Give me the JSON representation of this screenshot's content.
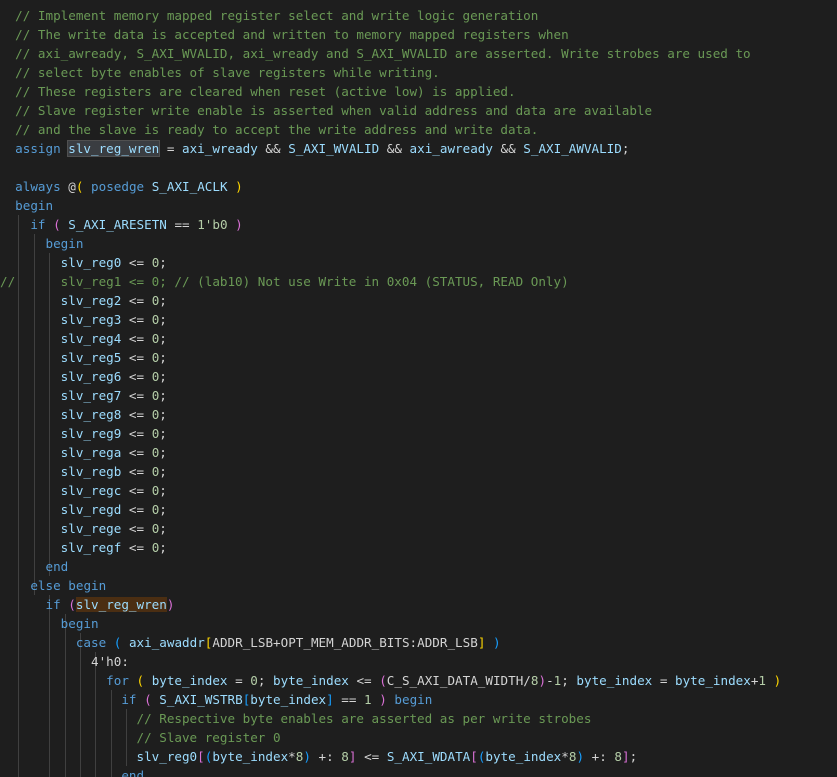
{
  "editor": {
    "language": "verilog",
    "lines": [
      {
        "indent": "  ",
        "tokens": [
          [
            "// Implement memory mapped register select and write logic generation",
            "comment"
          ]
        ]
      },
      {
        "indent": "  ",
        "tokens": [
          [
            "// The write data is accepted and written to memory mapped registers when",
            "comment"
          ]
        ]
      },
      {
        "indent": "  ",
        "tokens": [
          [
            "// axi_awready, S_AXI_WVALID, axi_wready and S_AXI_WVALID are asserted. Write strobes are used to",
            "comment"
          ]
        ]
      },
      {
        "indent": "  ",
        "tokens": [
          [
            "// select byte enables of slave registers while writing.",
            "comment"
          ]
        ]
      },
      {
        "indent": "  ",
        "tokens": [
          [
            "// These registers are cleared when reset (active low) is applied.",
            "comment"
          ]
        ]
      },
      {
        "indent": "  ",
        "tokens": [
          [
            "// Slave register write enable is asserted when valid address and data are available",
            "comment"
          ]
        ]
      },
      {
        "indent": "  ",
        "tokens": [
          [
            "// and the slave is ready to accept the write address and write data.",
            "comment"
          ]
        ]
      },
      {
        "indent": "  ",
        "tokens": [
          [
            "assign",
            "keyword"
          ],
          [
            " ",
            "plain"
          ],
          [
            "slv_reg_wren",
            "ident-select"
          ],
          [
            " = ",
            "plain"
          ],
          [
            "axi_wready",
            "ident"
          ],
          [
            " && ",
            "plain"
          ],
          [
            "S_AXI_WVALID",
            "ident"
          ],
          [
            " && ",
            "plain"
          ],
          [
            "axi_awready",
            "ident"
          ],
          [
            " && ",
            "plain"
          ],
          [
            "S_AXI_AWVALID",
            "ident"
          ],
          [
            ";",
            "plain"
          ]
        ]
      },
      {
        "indent": "",
        "tokens": []
      },
      {
        "indent": "  ",
        "tokens": [
          [
            "always",
            "keyword"
          ],
          [
            " ",
            "plain"
          ],
          [
            "@",
            "plain"
          ],
          [
            "(",
            "bracket-1"
          ],
          [
            " ",
            "plain"
          ],
          [
            "posedge",
            "keyword"
          ],
          [
            " ",
            "plain"
          ],
          [
            "S_AXI_ACLK",
            "ident"
          ],
          [
            " ",
            "plain"
          ],
          [
            ")",
            "bracket-1"
          ]
        ]
      },
      {
        "indent": "  ",
        "tokens": [
          [
            "begin",
            "keyword"
          ]
        ]
      },
      {
        "indent": "    ",
        "tokens": [
          [
            "if",
            "keyword"
          ],
          [
            " ",
            "plain"
          ],
          [
            "(",
            "bracket-2"
          ],
          [
            " ",
            "plain"
          ],
          [
            "S_AXI_ARESETN",
            "ident"
          ],
          [
            " == ",
            "plain"
          ],
          [
            "1'b0",
            "number"
          ],
          [
            " ",
            "plain"
          ],
          [
            ")",
            "bracket-2"
          ]
        ]
      },
      {
        "indent": "      ",
        "tokens": [
          [
            "begin",
            "keyword"
          ]
        ]
      },
      {
        "indent": "        ",
        "tokens": [
          [
            "slv_reg0",
            "ident"
          ],
          [
            " <= ",
            "plain"
          ],
          [
            "0",
            "number"
          ],
          [
            ";",
            "plain"
          ]
        ]
      },
      {
        "indent": "//      ",
        "tokens": [
          [
            "slv_reg1 <= 0; // (lab10) Not use Write in 0x04 (STATUS, READ Only)",
            "comment"
          ]
        ]
      },
      {
        "indent": "        ",
        "tokens": [
          [
            "slv_reg2",
            "ident"
          ],
          [
            " <= ",
            "plain"
          ],
          [
            "0",
            "number"
          ],
          [
            ";",
            "plain"
          ]
        ]
      },
      {
        "indent": "        ",
        "tokens": [
          [
            "slv_reg3",
            "ident"
          ],
          [
            " <= ",
            "plain"
          ],
          [
            "0",
            "number"
          ],
          [
            ";",
            "plain"
          ]
        ]
      },
      {
        "indent": "        ",
        "tokens": [
          [
            "slv_reg4",
            "ident"
          ],
          [
            " <= ",
            "plain"
          ],
          [
            "0",
            "number"
          ],
          [
            ";",
            "plain"
          ]
        ]
      },
      {
        "indent": "        ",
        "tokens": [
          [
            "slv_reg5",
            "ident"
          ],
          [
            " <= ",
            "plain"
          ],
          [
            "0",
            "number"
          ],
          [
            ";",
            "plain"
          ]
        ]
      },
      {
        "indent": "        ",
        "tokens": [
          [
            "slv_reg6",
            "ident"
          ],
          [
            " <= ",
            "plain"
          ],
          [
            "0",
            "number"
          ],
          [
            ";",
            "plain"
          ]
        ]
      },
      {
        "indent": "        ",
        "tokens": [
          [
            "slv_reg7",
            "ident"
          ],
          [
            " <= ",
            "plain"
          ],
          [
            "0",
            "number"
          ],
          [
            ";",
            "plain"
          ]
        ]
      },
      {
        "indent": "        ",
        "tokens": [
          [
            "slv_reg8",
            "ident"
          ],
          [
            " <= ",
            "plain"
          ],
          [
            "0",
            "number"
          ],
          [
            ";",
            "plain"
          ]
        ]
      },
      {
        "indent": "        ",
        "tokens": [
          [
            "slv_reg9",
            "ident"
          ],
          [
            " <= ",
            "plain"
          ],
          [
            "0",
            "number"
          ],
          [
            ";",
            "plain"
          ]
        ]
      },
      {
        "indent": "        ",
        "tokens": [
          [
            "slv_rega",
            "ident"
          ],
          [
            " <= ",
            "plain"
          ],
          [
            "0",
            "number"
          ],
          [
            ";",
            "plain"
          ]
        ]
      },
      {
        "indent": "        ",
        "tokens": [
          [
            "slv_regb",
            "ident"
          ],
          [
            " <= ",
            "plain"
          ],
          [
            "0",
            "number"
          ],
          [
            ";",
            "plain"
          ]
        ]
      },
      {
        "indent": "        ",
        "tokens": [
          [
            "slv_regc",
            "ident"
          ],
          [
            " <= ",
            "plain"
          ],
          [
            "0",
            "number"
          ],
          [
            ";",
            "plain"
          ]
        ]
      },
      {
        "indent": "        ",
        "tokens": [
          [
            "slv_regd",
            "ident"
          ],
          [
            " <= ",
            "plain"
          ],
          [
            "0",
            "number"
          ],
          [
            ";",
            "plain"
          ]
        ]
      },
      {
        "indent": "        ",
        "tokens": [
          [
            "slv_rege",
            "ident"
          ],
          [
            " <= ",
            "plain"
          ],
          [
            "0",
            "number"
          ],
          [
            ";",
            "plain"
          ]
        ]
      },
      {
        "indent": "        ",
        "tokens": [
          [
            "slv_regf",
            "ident"
          ],
          [
            " <= ",
            "plain"
          ],
          [
            "0",
            "number"
          ],
          [
            ";",
            "plain"
          ]
        ]
      },
      {
        "indent": "      ",
        "tokens": [
          [
            "end",
            "keyword"
          ]
        ]
      },
      {
        "indent": "    ",
        "tokens": [
          [
            "else",
            "keyword"
          ],
          [
            " ",
            "plain"
          ],
          [
            "begin",
            "keyword"
          ]
        ]
      },
      {
        "indent": "      ",
        "tokens": [
          [
            "if",
            "keyword"
          ],
          [
            " ",
            "plain"
          ],
          [
            "(",
            "bracket-2-paren"
          ],
          [
            "slv_reg_wren",
            "ident-ref"
          ],
          [
            ")",
            "bracket-2-paren"
          ]
        ]
      },
      {
        "indent": "        ",
        "tokens": [
          [
            "begin",
            "keyword"
          ]
        ]
      },
      {
        "indent": "          ",
        "tokens": [
          [
            "case",
            "keyword"
          ],
          [
            " ",
            "plain"
          ],
          [
            "(",
            "bracket-3"
          ],
          [
            " ",
            "plain"
          ],
          [
            "axi_awaddr",
            "ident"
          ],
          [
            "[",
            "bracket-1"
          ],
          [
            "ADDR_LSB",
            "plain"
          ],
          [
            "+",
            "plain"
          ],
          [
            "OPT_MEM_ADDR_BITS",
            "plain"
          ],
          [
            ":",
            "plain"
          ],
          [
            "ADDR_LSB",
            "plain"
          ],
          [
            "]",
            "bracket-1"
          ],
          [
            " ",
            "plain"
          ],
          [
            ")",
            "bracket-3"
          ]
        ]
      },
      {
        "indent": "            ",
        "tokens": [
          [
            "4'h0",
            "number-soft"
          ],
          [
            ":",
            "plain"
          ]
        ]
      },
      {
        "indent": "              ",
        "tokens": [
          [
            "for",
            "keyword"
          ],
          [
            " ",
            "plain"
          ],
          [
            "(",
            "bracket-1"
          ],
          [
            " ",
            "plain"
          ],
          [
            "byte_index",
            "ident"
          ],
          [
            " = ",
            "plain"
          ],
          [
            "0",
            "number"
          ],
          [
            "; ",
            "plain"
          ],
          [
            "byte_index",
            "ident"
          ],
          [
            " <= ",
            "plain"
          ],
          [
            "(",
            "bracket-2"
          ],
          [
            "C_S_AXI_DATA_WIDTH",
            "plain"
          ],
          [
            "/",
            "plain"
          ],
          [
            "8",
            "number"
          ],
          [
            ")",
            "bracket-2"
          ],
          [
            "-",
            "plain"
          ],
          [
            "1",
            "number"
          ],
          [
            "; ",
            "plain"
          ],
          [
            "byte_index",
            "ident"
          ],
          [
            " = ",
            "plain"
          ],
          [
            "byte_index",
            "ident"
          ],
          [
            "+",
            "plain"
          ],
          [
            "1",
            "number"
          ],
          [
            " ",
            "plain"
          ],
          [
            ")",
            "bracket-1"
          ]
        ]
      },
      {
        "indent": "                ",
        "tokens": [
          [
            "if",
            "keyword"
          ],
          [
            " ",
            "plain"
          ],
          [
            "(",
            "bracket-2"
          ],
          [
            " ",
            "plain"
          ],
          [
            "S_AXI_WSTRB",
            "ident"
          ],
          [
            "[",
            "bracket-3"
          ],
          [
            "byte_index",
            "ident"
          ],
          [
            "]",
            "bracket-3"
          ],
          [
            " == ",
            "plain"
          ],
          [
            "1",
            "number"
          ],
          [
            " ",
            "plain"
          ],
          [
            ")",
            "bracket-2"
          ],
          [
            " ",
            "plain"
          ],
          [
            "begin",
            "keyword"
          ]
        ]
      },
      {
        "indent": "                  ",
        "tokens": [
          [
            "// Respective byte enables are asserted as per write strobes",
            "comment"
          ]
        ]
      },
      {
        "indent": "                  ",
        "tokens": [
          [
            "// Slave register 0",
            "comment"
          ]
        ]
      },
      {
        "indent": "                  ",
        "tokens": [
          [
            "slv_reg0",
            "ident"
          ],
          [
            "[",
            "bracket-2"
          ],
          [
            "(",
            "bracket-3"
          ],
          [
            "byte_index",
            "ident"
          ],
          [
            "*",
            "plain"
          ],
          [
            "8",
            "number"
          ],
          [
            ")",
            "bracket-3"
          ],
          [
            " +: ",
            "plain"
          ],
          [
            "8",
            "number"
          ],
          [
            "]",
            "bracket-2"
          ],
          [
            " <= ",
            "plain"
          ],
          [
            "S_AXI_WDATA",
            "ident"
          ],
          [
            "[",
            "bracket-2"
          ],
          [
            "(",
            "bracket-3"
          ],
          [
            "byte_index",
            "ident"
          ],
          [
            "*",
            "plain"
          ],
          [
            "8",
            "number"
          ],
          [
            ")",
            "bracket-3"
          ],
          [
            " +: ",
            "plain"
          ],
          [
            "8",
            "number"
          ],
          [
            "]",
            "bracket-2"
          ],
          [
            ";",
            "plain"
          ]
        ]
      },
      {
        "indent": "                ",
        "tokens": [
          [
            "end",
            "keyword"
          ]
        ]
      }
    ]
  }
}
